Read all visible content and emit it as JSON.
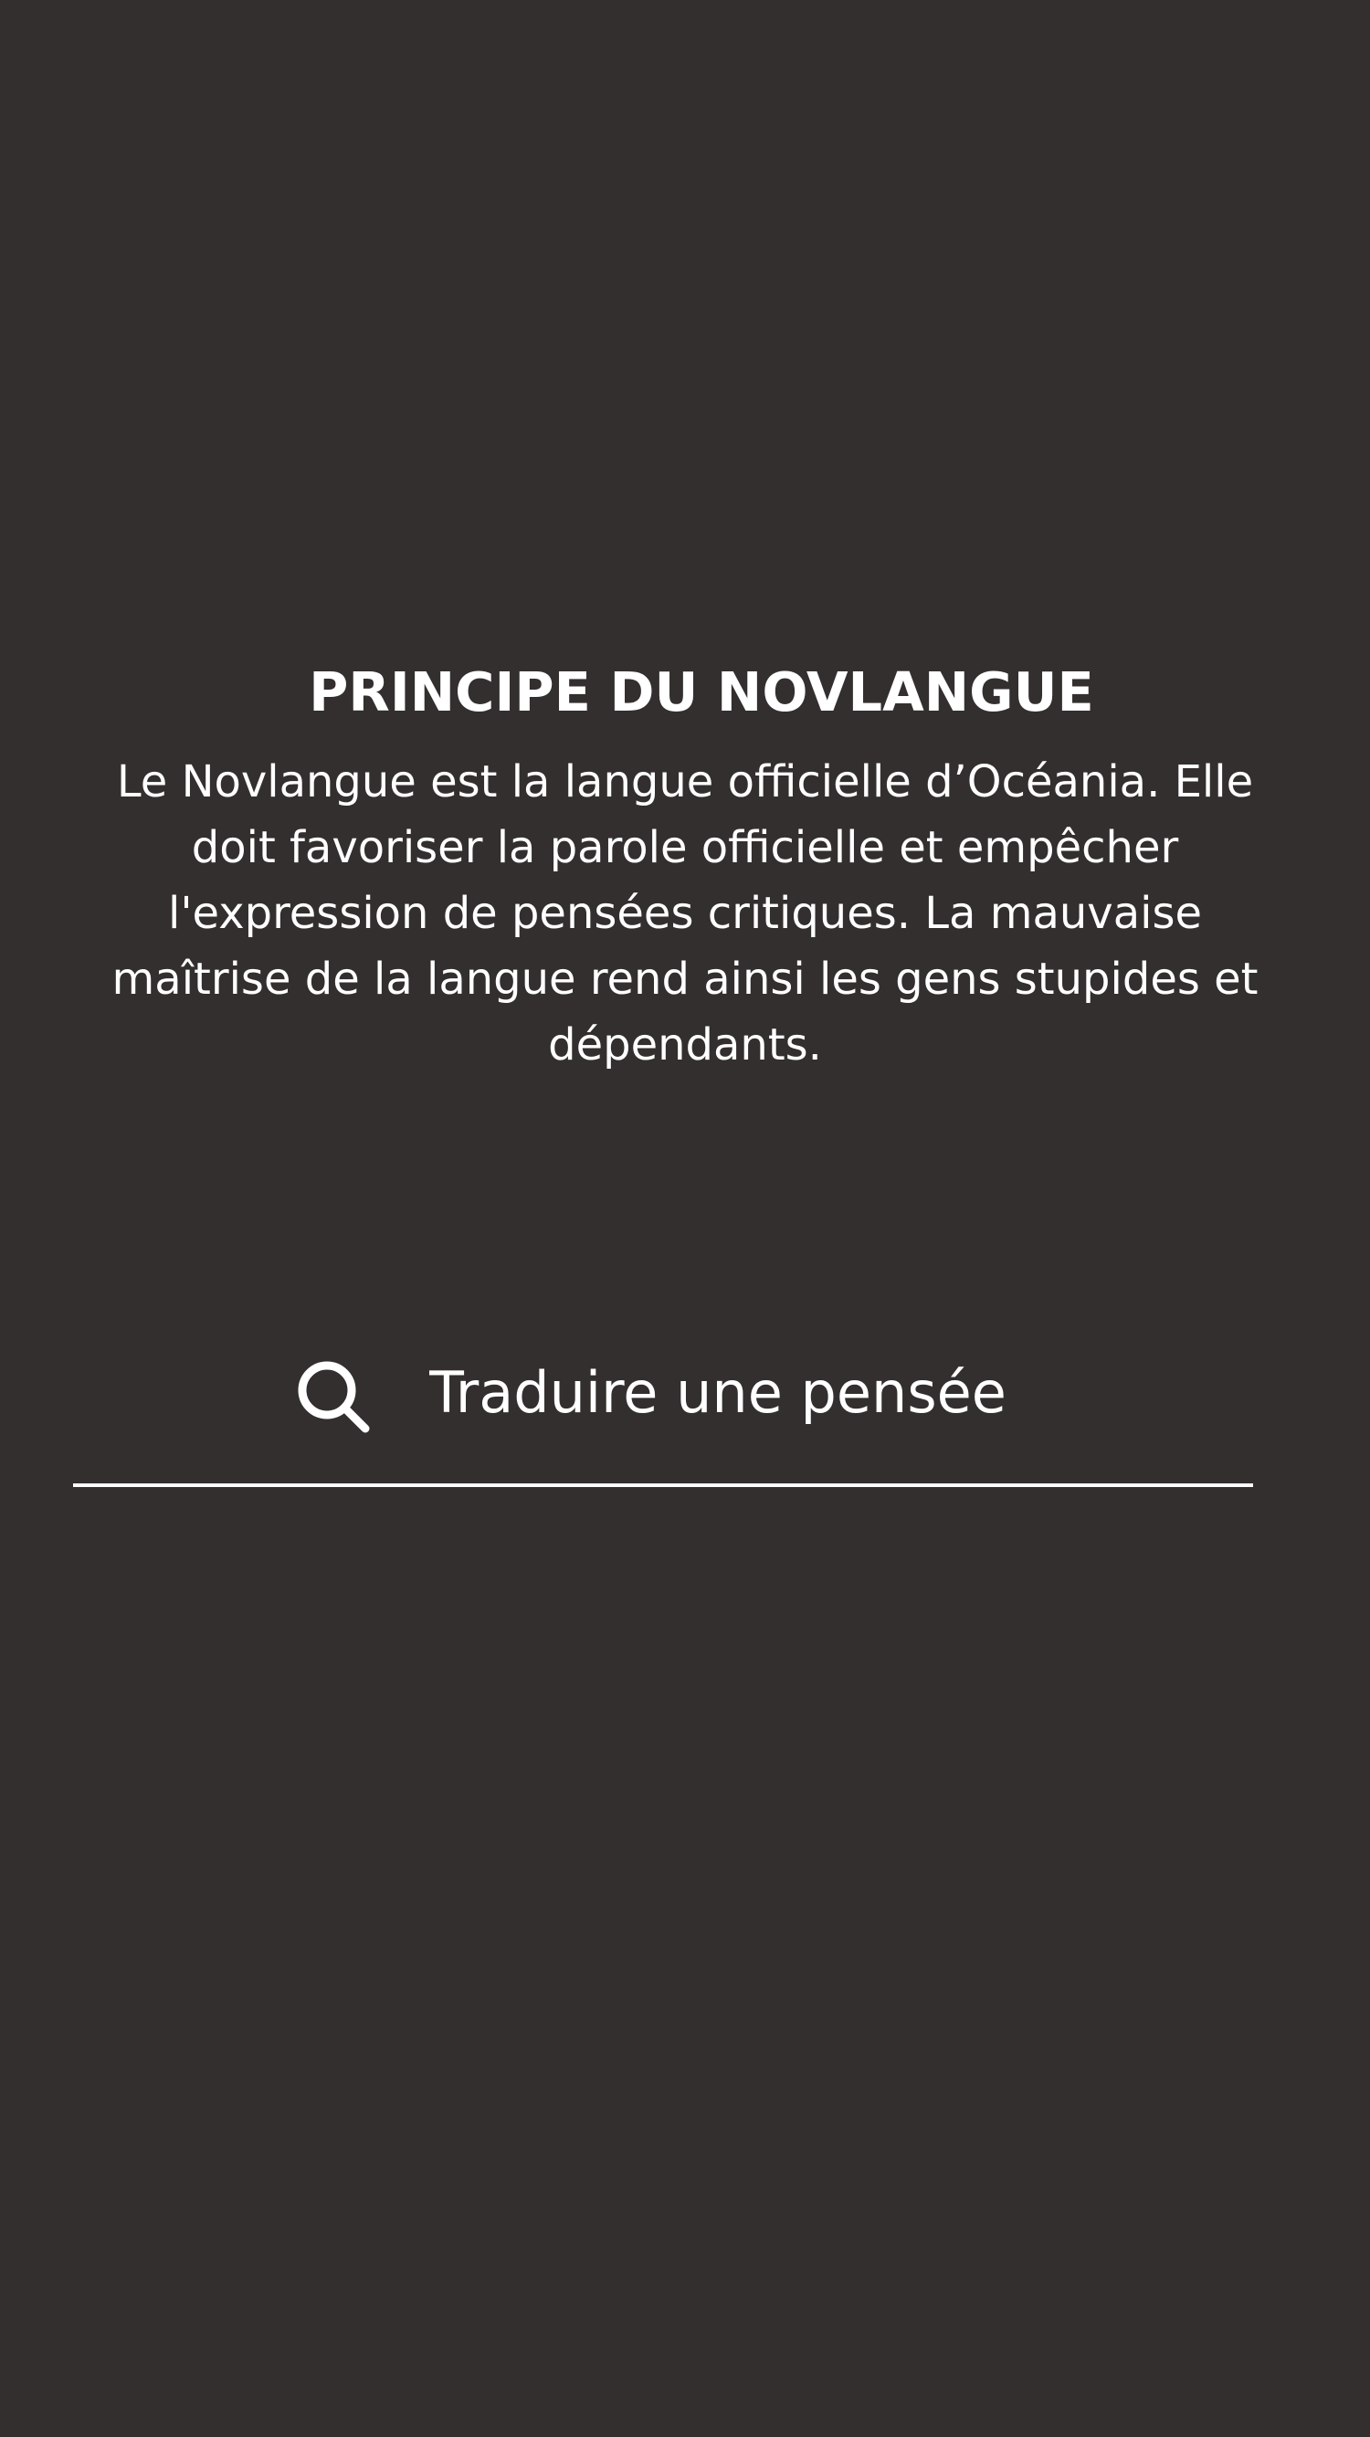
{
  "intro": {
    "title": "PRINCIPE DU NOVLANGUE",
    "description": "Le Novlangue est la langue officielle d’Océania. Elle doit favoriser la parole officielle et empêcher l'expression de pensées critiques. La mauvaise maîtrise de la langue rend ainsi les gens stupides et dépendants."
  },
  "search": {
    "icon": "search-icon",
    "placeholder": "Traduire une pensée"
  },
  "colors": {
    "background": "#332f2e",
    "text": "#ffffff"
  }
}
